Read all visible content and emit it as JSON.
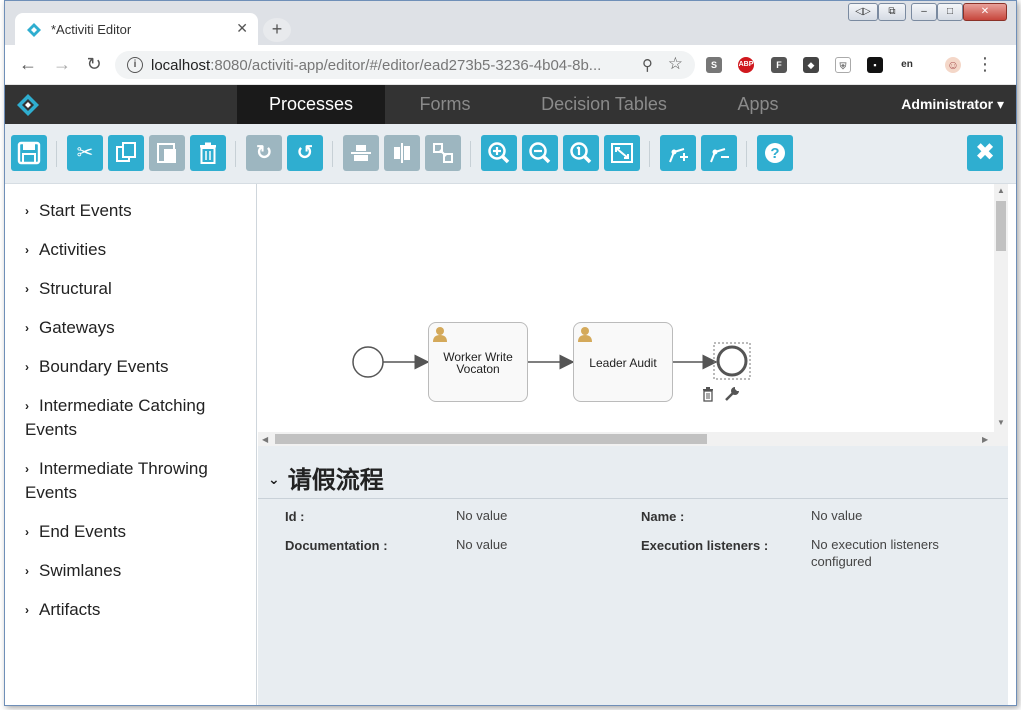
{
  "browser": {
    "tab_title": "*Activiti Editor",
    "url_host": "localhost",
    "url_rest": ":8080/activiti-app/editor/#/editor/ead273b5-3236-4b04-8b...",
    "extensions": [
      "S",
      "ABP",
      "F",
      "◆",
      "⛨",
      "▪",
      "en",
      "☺"
    ]
  },
  "appnav": {
    "tabs": [
      "Processes",
      "Forms",
      "Decision Tables",
      "Apps"
    ],
    "active_tab": "Processes",
    "user": "Administrator"
  },
  "toolbar": {
    "buttons": [
      "save",
      "cut",
      "copy",
      "paste",
      "delete",
      "redo",
      "undo",
      "align-horizontal",
      "align-vertical",
      "same-size",
      "zoom-in",
      "zoom-out",
      "zoom-actual",
      "zoom-fit",
      "bend-point-add",
      "bend-point-remove",
      "help",
      "close"
    ]
  },
  "palette": {
    "items": [
      {
        "label": "Start Events"
      },
      {
        "label": "Activities"
      },
      {
        "label": "Structural"
      },
      {
        "label": "Gateways"
      },
      {
        "label": "Boundary Events"
      },
      {
        "label": "Intermediate Catching",
        "label2": "Events"
      },
      {
        "label": "Intermediate Throwing",
        "label2": "Events"
      },
      {
        "label": "End Events"
      },
      {
        "label": "Swimlanes"
      },
      {
        "label": "Artifacts"
      }
    ]
  },
  "diagram": {
    "task1_line1": "Worker Write",
    "task1_line2": "Vocaton",
    "task2": "Leader Audit"
  },
  "properties": {
    "title": "请假流程",
    "id_label": "Id :",
    "id_value": "No value",
    "name_label": "Name :",
    "name_value": "No value",
    "doc_label": "Documentation :",
    "doc_value": "No value",
    "listeners_label": "Execution listeners :",
    "listeners_value_1": "No execution listeners",
    "listeners_value_2": "configured"
  },
  "colors": {
    "toolbar_button": "#2faed0",
    "toolbar_button_disabled": "#9db6c0",
    "header_bg": "#333333"
  }
}
